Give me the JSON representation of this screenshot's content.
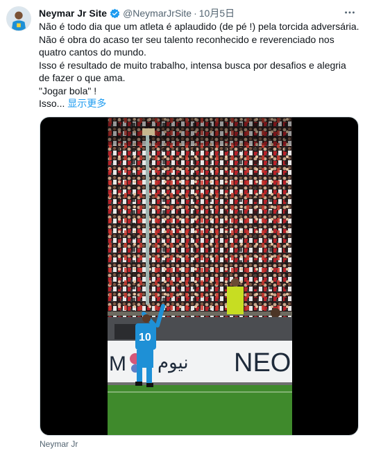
{
  "author": {
    "name": "Neymar Jr Site",
    "handle": "@NeymarJrSite",
    "separator": "·",
    "date": "10月5日"
  },
  "tweet": {
    "lines": [
      "Não é todo dia que um atleta é aplaudido (de pé !) pela torcida adversária.",
      "Não é obra do acaso ter seu talento reconhecido e reverenciado nos quatro cantos do mundo.",
      "Isso é resultado de muito trabalho, intensa busca por desafios e alegria de fazer o que ama.",
      "\"Jogar bola\" !",
      "Isso..."
    ],
    "show_more": "显示更多"
  },
  "media": {
    "player_number": "10",
    "banner_text_left": "M",
    "banner_text_arabic": "نيوم",
    "banner_text_right": "NEO"
  },
  "footer": {
    "caption": "Neymar Jr"
  },
  "colors": {
    "link": "#1d9bf0",
    "verified": "#1d9bf0",
    "jersey": "#1e90d6",
    "pitch": "#3f8a2c"
  },
  "icons": {
    "verified": "verified-badge-icon",
    "more": "more-options-icon"
  }
}
